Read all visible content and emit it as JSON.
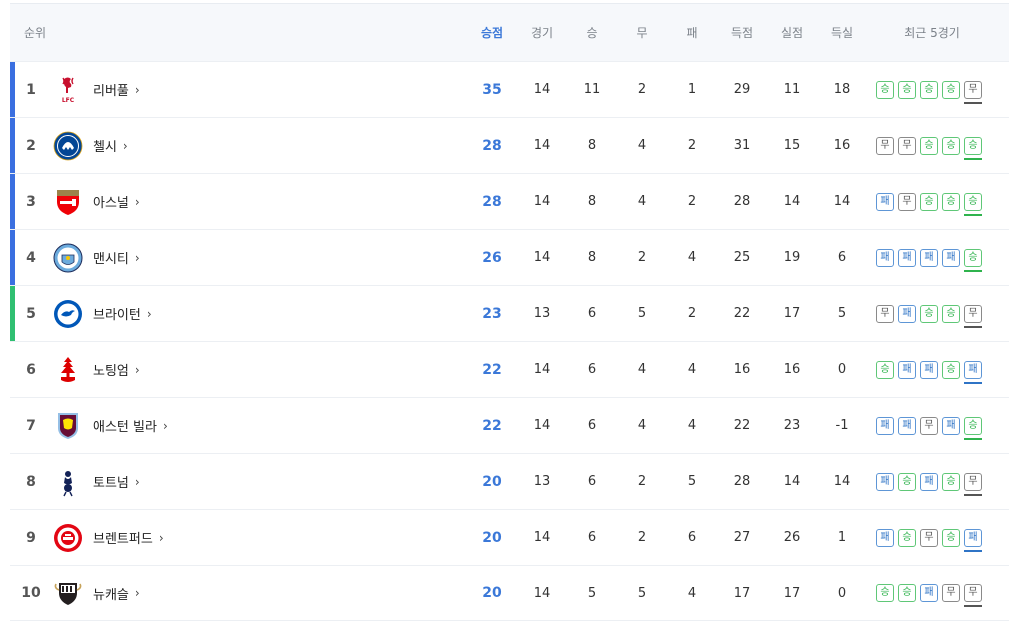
{
  "header": {
    "rank": "순위",
    "pts": "승점",
    "gp": "경기",
    "w": "승",
    "d": "무",
    "l": "패",
    "gf": "득점",
    "ga": "실점",
    "gd": "득실",
    "form": "최근 5경기"
  },
  "colors": {
    "champions_league": "#3a6fe0",
    "europa": "#2fbf71",
    "win": "#2fb34d",
    "loss": "#2f74c6",
    "draw": "#555555",
    "points": "#3b78d8"
  },
  "form_labels": {
    "W": "승",
    "D": "무",
    "L": "패"
  },
  "rows": [
    {
      "rank": "1",
      "team": "리버풀",
      "crest": "liverpool-crest",
      "pts": "35",
      "gp": "14",
      "w": "11",
      "d": "2",
      "l": "1",
      "gf": "29",
      "ga": "11",
      "gd": "18",
      "zone": "champions_league",
      "form": [
        "W",
        "W",
        "W",
        "W",
        "D"
      ]
    },
    {
      "rank": "2",
      "team": "첼시",
      "crest": "chelsea-crest",
      "pts": "28",
      "gp": "14",
      "w": "8",
      "d": "4",
      "l": "2",
      "gf": "31",
      "ga": "15",
      "gd": "16",
      "zone": "champions_league",
      "form": [
        "D",
        "D",
        "W",
        "W",
        "W"
      ]
    },
    {
      "rank": "3",
      "team": "아스널",
      "crest": "arsenal-crest",
      "pts": "28",
      "gp": "14",
      "w": "8",
      "d": "4",
      "l": "2",
      "gf": "28",
      "ga": "14",
      "gd": "14",
      "zone": "champions_league",
      "form": [
        "L",
        "D",
        "W",
        "W",
        "W"
      ]
    },
    {
      "rank": "4",
      "team": "맨시티",
      "crest": "man-city-crest",
      "pts": "26",
      "gp": "14",
      "w": "8",
      "d": "2",
      "l": "4",
      "gf": "25",
      "ga": "19",
      "gd": "6",
      "zone": "champions_league",
      "form": [
        "L",
        "L",
        "L",
        "L",
        "W"
      ]
    },
    {
      "rank": "5",
      "team": "브라이턴",
      "crest": "brighton-crest",
      "pts": "23",
      "gp": "13",
      "w": "6",
      "d": "5",
      "l": "2",
      "gf": "22",
      "ga": "17",
      "gd": "5",
      "zone": "europa",
      "form": [
        "D",
        "L",
        "W",
        "W",
        "D"
      ]
    },
    {
      "rank": "6",
      "team": "노팅엄",
      "crest": "nottingham-forest-crest",
      "pts": "22",
      "gp": "14",
      "w": "6",
      "d": "4",
      "l": "4",
      "gf": "16",
      "ga": "16",
      "gd": "0",
      "zone": "",
      "form": [
        "W",
        "L",
        "L",
        "W",
        "L"
      ]
    },
    {
      "rank": "7",
      "team": "애스턴 빌라",
      "crest": "aston-villa-crest",
      "pts": "22",
      "gp": "14",
      "w": "6",
      "d": "4",
      "l": "4",
      "gf": "22",
      "ga": "23",
      "gd": "-1",
      "zone": "",
      "form": [
        "L",
        "L",
        "D",
        "L",
        "W"
      ]
    },
    {
      "rank": "8",
      "team": "토트넘",
      "crest": "tottenham-crest",
      "pts": "20",
      "gp": "13",
      "w": "6",
      "d": "2",
      "l": "5",
      "gf": "28",
      "ga": "14",
      "gd": "14",
      "zone": "",
      "form": [
        "L",
        "W",
        "L",
        "W",
        "D"
      ]
    },
    {
      "rank": "9",
      "team": "브렌트퍼드",
      "crest": "brentford-crest",
      "pts": "20",
      "gp": "14",
      "w": "6",
      "d": "2",
      "l": "6",
      "gf": "27",
      "ga": "26",
      "gd": "1",
      "zone": "",
      "form": [
        "L",
        "W",
        "D",
        "W",
        "L"
      ]
    },
    {
      "rank": "10",
      "team": "뉴캐슬",
      "crest": "newcastle-crest",
      "pts": "20",
      "gp": "14",
      "w": "5",
      "d": "5",
      "l": "4",
      "gf": "17",
      "ga": "17",
      "gd": "0",
      "zone": "",
      "form": [
        "W",
        "W",
        "L",
        "D",
        "D"
      ]
    }
  ]
}
